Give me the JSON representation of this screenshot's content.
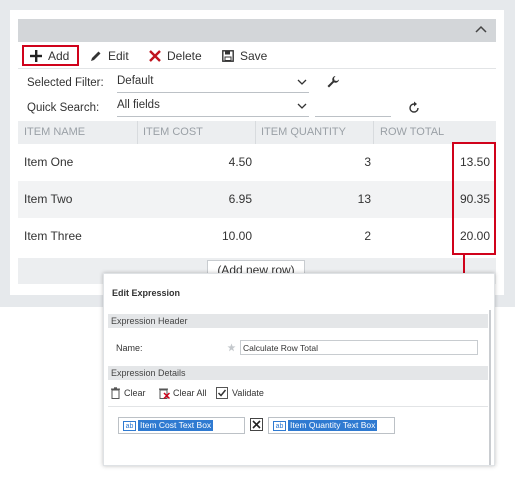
{
  "toolbar": {
    "add_label": "Add",
    "edit_label": "Edit",
    "delete_label": "Delete",
    "save_label": "Save"
  },
  "filter": {
    "label": "Selected Filter:",
    "value": "Default"
  },
  "quick_search": {
    "label": "Quick Search:",
    "value": "All fields"
  },
  "grid": {
    "columns": [
      "ITEM NAME",
      "ITEM COST",
      "ITEM QUANTITY",
      "ROW TOTAL"
    ],
    "rows": [
      {
        "name": "Item One",
        "cost": "4.50",
        "quantity": "3",
        "total": "13.50"
      },
      {
        "name": "Item Two",
        "cost": "6.95",
        "quantity": "13",
        "total": "90.35"
      },
      {
        "name": "Item Three",
        "cost": "10.00",
        "quantity": "2",
        "total": "20.00"
      }
    ],
    "add_row_label": "(Add new row)"
  },
  "dialog": {
    "title": "Edit Expression",
    "header_section": "Expression Header",
    "name_label": "Name:",
    "name_value": "Calculate Row Total",
    "details_section": "Expression Details",
    "clear_label": "Clear",
    "clear_all_label": "Clear All",
    "validate_label": "Validate",
    "token1": "Item Cost Text Box",
    "token2": "Item Quantity Text Box",
    "token_icon_text": "ab"
  },
  "colors": {
    "highlight": "#d0021b",
    "token": "#2f7ad1",
    "header_bg": "#eceef0"
  }
}
